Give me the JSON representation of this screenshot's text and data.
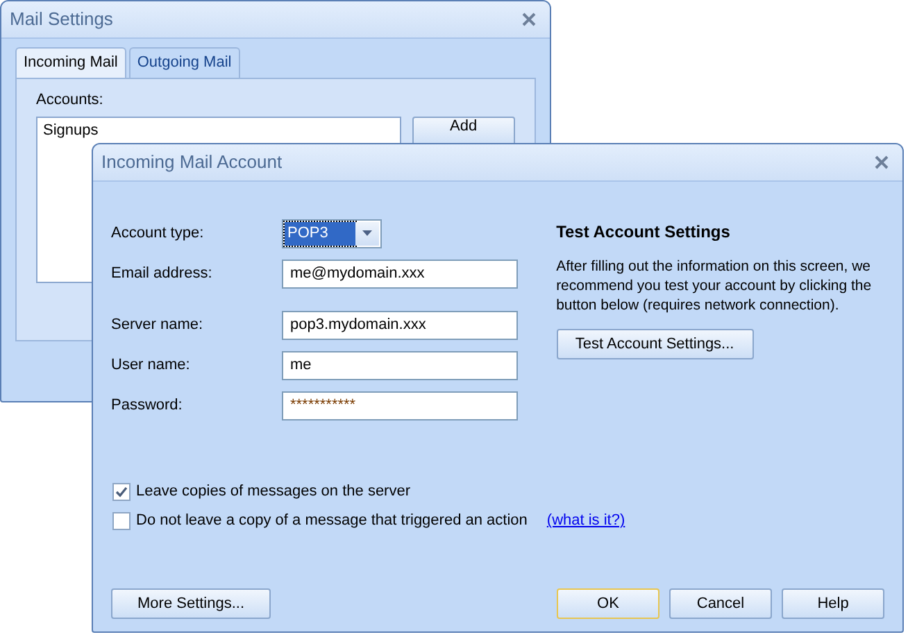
{
  "background_window": {
    "title": "Mail Settings",
    "tabs": [
      {
        "label": "Incoming Mail",
        "selected": true
      },
      {
        "label": "Outgoing Mail",
        "selected": false
      }
    ],
    "accounts_label": "Accounts:",
    "accounts": [
      {
        "name": "Signups"
      }
    ],
    "add_button": "Add"
  },
  "dialog": {
    "title": "Incoming Mail Account",
    "account_fields": [
      {
        "kind": "select",
        "label": "Account type:",
        "value": "POP3"
      },
      {
        "kind": "text",
        "label": "Email address:",
        "value": "me@mydomain.xxx"
      }
    ],
    "server_fields": [
      {
        "kind": "text",
        "label": "Server name:",
        "value": "pop3.mydomain.xxx"
      },
      {
        "kind": "text",
        "label": "User name:",
        "value": "me"
      },
      {
        "kind": "password",
        "label": "Password:",
        "value": "***********"
      }
    ],
    "test_section": {
      "heading": "Test Account Settings",
      "description": "After filling out the information on this screen, we recommend you test your account by clicking the button below (requires network connection).",
      "button": "Test Account Settings..."
    },
    "options": [
      {
        "label": "Leave copies of messages on the server",
        "checked": true
      },
      {
        "label": "Do not leave a copy of a message that triggered an action",
        "checked": false,
        "link": "(what is it?)"
      }
    ],
    "left_buttons": [
      {
        "label": "More Settings...",
        "default": false
      }
    ],
    "right_buttons": [
      {
        "label": "OK",
        "default": true
      },
      {
        "label": "Cancel",
        "default": false
      },
      {
        "label": "Help",
        "default": false
      }
    ]
  }
}
